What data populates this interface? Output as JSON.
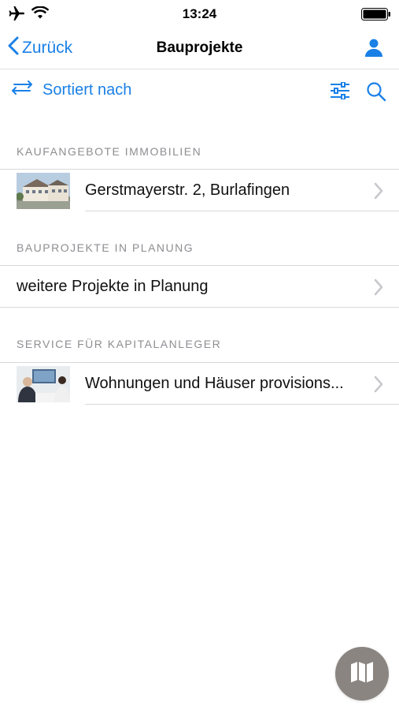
{
  "status_bar": {
    "time": "13:24"
  },
  "nav": {
    "back_label": "Zurück",
    "title": "Bauprojekte"
  },
  "toolbar": {
    "sort_label": "Sortiert nach"
  },
  "sections": [
    {
      "header": "KAUFANGEBOTE IMMOBILIEN",
      "items": [
        {
          "label": "Gerstmayerstr. 2, Burlafingen",
          "thumbnail": "building-photo"
        }
      ]
    },
    {
      "header": "BAUPROJEKTE IN PLANUNG",
      "items": [
        {
          "label": "weitere Projekte in Planung"
        }
      ]
    },
    {
      "header": "SERVICE FÜR KAPITALANLEGER",
      "items": [
        {
          "label": "Wohnungen und Häuser provisions...",
          "thumbnail": "meeting-photo"
        }
      ]
    }
  ],
  "colors": {
    "accent": "#1a80e6",
    "section_text": "#8e8e93",
    "fab": "#8a8580"
  },
  "icons": [
    "airplane-icon",
    "wifi-icon",
    "battery-icon",
    "chevron-left-icon",
    "user-icon",
    "sort-arrows-icon",
    "filter-sliders-icon",
    "search-icon",
    "chevron-right-icon",
    "map-icon"
  ]
}
